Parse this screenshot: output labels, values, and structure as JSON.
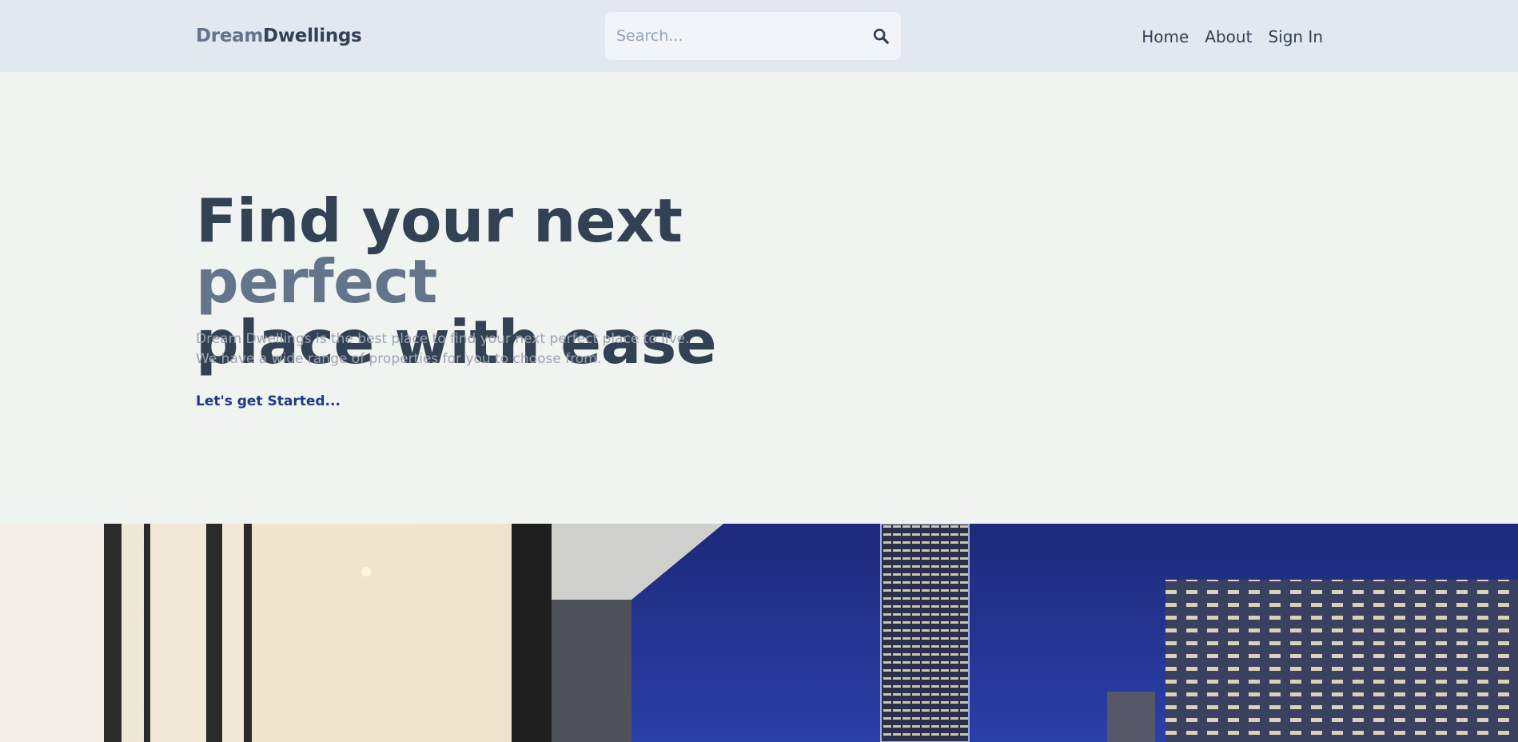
{
  "header": {
    "logo_part1": "Dream",
    "logo_part2": "Dwellings",
    "search": {
      "placeholder": "Search...",
      "icon": "search-icon"
    },
    "nav": [
      "Home",
      "About",
      "Sign In"
    ]
  },
  "hero": {
    "title_line1_a": "Find your next ",
    "title_line1_b": "perfect",
    "title_line2": "place with ease",
    "description_line1": "Dream Dwellings is the best place to find your next perfect place to live.",
    "description_line2": "We have a wide range of properties for you to choose from.",
    "cta": "Let's get Started..."
  },
  "colors": {
    "header_bg": "#e2e8f0",
    "page_bg": "#f0f4f1",
    "text_dark": "#334155",
    "text_accent": "#64748b",
    "link": "#1e3a8a"
  }
}
